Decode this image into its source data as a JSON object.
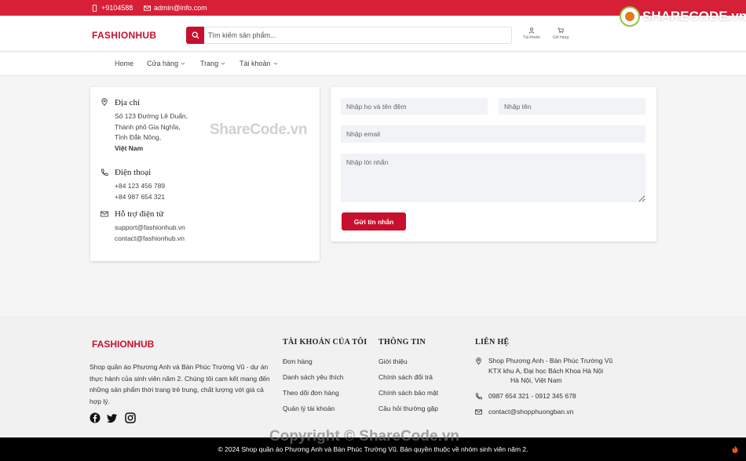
{
  "topbar": {
    "phone": "+9104588",
    "email": "admin@info.com"
  },
  "header": {
    "logo": "FASHIONHUB",
    "search_placeholder": "Tìm kiếm sản phẩm...",
    "account_label": "Tài khoản",
    "cart_label": "Giỏ hàng"
  },
  "badge": {
    "text": "SHARECODE.vn"
  },
  "nav": {
    "items": [
      {
        "label": "Home"
      },
      {
        "label": "Cửa hàng"
      },
      {
        "label": "Trang"
      },
      {
        "label": "Tài khoản"
      }
    ]
  },
  "contact_info": {
    "address_title": "Địa chỉ",
    "address_lines": [
      "Số 123 Đường Lê Duẩn,",
      "Thành phố Gia Nghĩa,",
      "Tỉnh Đắk Nông,",
      "Việt Nam"
    ],
    "phone_title": "Điện thoại",
    "phones": [
      "+84 123 456 789",
      "+84 987 654 321"
    ],
    "email_title": "Hỗ trợ điện tử",
    "emails": [
      "support@fashionhub.vn",
      "contact@fashionhub.vn"
    ]
  },
  "form": {
    "lastname_placeholder": "Nhập họ và tên đệm",
    "firstname_placeholder": "Nhập tên",
    "email_placeholder": "Nhập email",
    "message_placeholder": "Nhập lời nhắn",
    "submit_label": "Gửi tin nhắn"
  },
  "watermark": "ShareCode.vn",
  "footer": {
    "logo": "FASHIONHUB",
    "description": "Shop quần áo Phương Anh và Bàn Phúc Trường Vũ - dự án thực hành của sinh viên năm 2. Chúng tôi cam kết mang đến những sản phẩm thời trang trẻ trung, chất lượng với giá cả hợp lý.",
    "account_heading": "TÀI KHOẢN CỦA TÔI",
    "account_links": [
      "Đơn hàng",
      "Danh sách yêu thích",
      "Theo dõi đơn hàng",
      "Quản lý tài khoản"
    ],
    "info_heading": "THÔNG TIN",
    "info_links": [
      "Giới thiệu",
      "Chính sách đổi trả",
      "Chính sách bảo mật",
      "Câu hỏi thường gặp"
    ],
    "contact_heading": "LIÊN HỆ",
    "contact_address_lines": [
      "Shop Phương Anh - Bàn Phúc Trường Vũ",
      "KTX khu A, Đại học Bách Khoa Hà Nội",
      "Hà Nội, Việt Nam"
    ],
    "contact_phone": "0987 654 321 - 0912 345 678",
    "contact_email": "contact@shopphuongban.vn"
  },
  "bottombar": {
    "copyright": "© 2024 Shop quần áo Phương Anh và Bàn Phúc Trường Vũ. Bản quyền thuộc về nhóm sinh viên năm 2.",
    "watermark": "Copyright © ShareCode.vn"
  },
  "colors": {
    "brand": "#c8102e",
    "topbar": "#d71f37",
    "footer_bg": "#f1f1f1"
  }
}
